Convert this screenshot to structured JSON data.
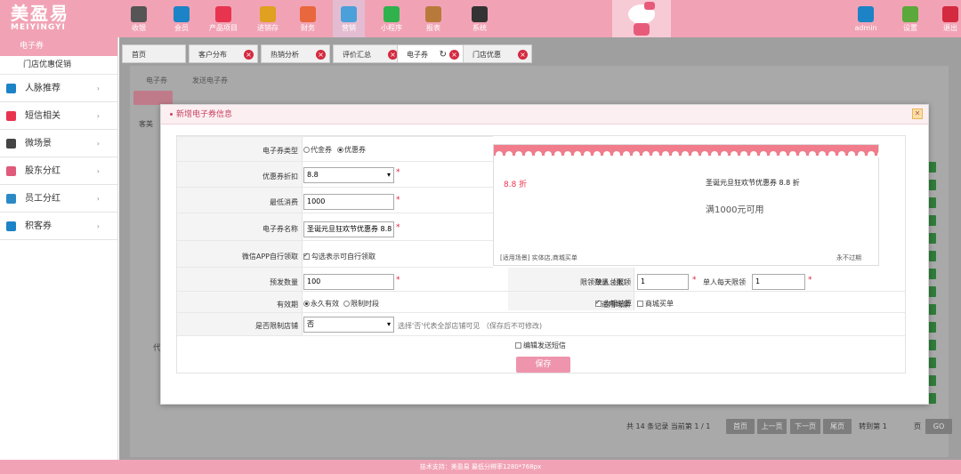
{
  "app": {
    "logo_cn": "美盈易",
    "logo_en": "MEIYINGYI"
  },
  "topnav": [
    {
      "label": "收银",
      "icon": "cash-register-icon",
      "color": "#555555"
    },
    {
      "label": "会员",
      "icon": "member-icon",
      "color": "#1c83c6"
    },
    {
      "label": "产品项目",
      "icon": "product-icon",
      "color": "#e8344f"
    },
    {
      "label": "进销存",
      "icon": "inventory-icon",
      "color": "#e0a020"
    },
    {
      "label": "财务",
      "icon": "finance-icon",
      "color": "#e8673c"
    },
    {
      "label": "营销",
      "icon": "megaphone-icon",
      "color": "#4aa0d8"
    },
    {
      "label": "小程序",
      "icon": "wechat-icon",
      "color": "#2fb24c"
    },
    {
      "label": "报表",
      "icon": "report-icon",
      "color": "#b87a3a"
    },
    {
      "label": "系统",
      "icon": "monitor-icon",
      "color": "#333333"
    }
  ],
  "topright": [
    {
      "label": "admin",
      "icon": "user-icon",
      "color": "#1c83c6"
    },
    {
      "label": "设置",
      "icon": "gear-icon",
      "color": "#5aa93a"
    },
    {
      "label": "退出",
      "icon": "logout-icon",
      "color": "#d42a3f"
    }
  ],
  "sidebar": {
    "head": "电子券",
    "sub": "门店优惠促销",
    "items": [
      {
        "label": "人脉推荐",
        "icon": "network-icon",
        "color": "#1c83c6"
      },
      {
        "label": "短信相关",
        "icon": "phone-icon",
        "color": "#e8344f"
      },
      {
        "label": "微场景",
        "icon": "mobile-icon",
        "color": "#444444"
      },
      {
        "label": "股东分红",
        "icon": "share-icon",
        "color": "#e05a7a"
      },
      {
        "label": "员工分红",
        "icon": "staff-icon",
        "color": "#2b8ac6"
      },
      {
        "label": "积客券",
        "icon": "coupon-icon",
        "color": "#1c83c6"
      }
    ]
  },
  "tabs": [
    {
      "label": "首页",
      "closable": false
    },
    {
      "label": "客户分布",
      "closable": true
    },
    {
      "label": "热销分析",
      "closable": true
    },
    {
      "label": "评价汇总",
      "closable": true
    },
    {
      "label": "电子券",
      "closable": true,
      "active": true
    },
    {
      "label": "门店优惠",
      "closable": true
    }
  ],
  "background": {
    "subtabs": [
      "电子券",
      "发送电子券"
    ],
    "button": "新增",
    "cue": "客美",
    "left_text": "代",
    "pager": {
      "summary": "共 14 条记录 当前第 1 / 1",
      "first": "首页",
      "prev": "上一页",
      "next": "下一页",
      "last": "尾页",
      "goto": "转到第 1",
      "page": "页",
      "go": "GO"
    }
  },
  "modal": {
    "title": "新增电子券信息",
    "close": "✕",
    "type": {
      "label": "电子券类型",
      "options": [
        "代金券",
        "优惠券"
      ],
      "selected": "优惠券"
    },
    "discount": {
      "label": "优惠券折扣",
      "value": "8.8"
    },
    "min_spend": {
      "label": "最低消费",
      "value": "1000"
    },
    "name": {
      "label": "电子券名称",
      "value": "圣诞元旦狂欢节优惠券 8.8"
    },
    "wechat": {
      "label": "微信APP自行领取",
      "option": "勾选表示可自行领取",
      "checked": true
    },
    "issue_qty": {
      "label": "预发数量",
      "value": "100"
    },
    "limit": {
      "label": "限领数量（张）",
      "total_label": "单人总限领",
      "total_value": "1",
      "daily_label": "单人每天限领",
      "daily_value": "1"
    },
    "validity": {
      "label": "有效期",
      "options": [
        "永久有效",
        "限制时段"
      ],
      "selected": "永久有效"
    },
    "scene": {
      "label": "适用场景",
      "options": [
        "收银结算",
        "商城买单"
      ],
      "checked": [
        "收银结算"
      ]
    },
    "store_limit": {
      "label": "是否限制店铺",
      "value": "否",
      "note": "选择'否'代表全部店铺可见  （保存后不可修改)"
    },
    "sms": {
      "label": "编辑发送短信",
      "checked": false
    },
    "save": "保存",
    "preview": {
      "discount": "8.8 折",
      "title": "圣诞元旦狂欢节优惠券 8.8 折",
      "condition": "满1000元可用",
      "scene": "[适用场景] 实体店,商城买单",
      "expiry": "永不过期"
    }
  },
  "footer": "技术支持：美盈易   最低分辨率1280*768px",
  "colors": {
    "brand_pink": "#f1a3b5",
    "accent_red": "#d42a3f",
    "save_pink": "#ee95ad"
  }
}
